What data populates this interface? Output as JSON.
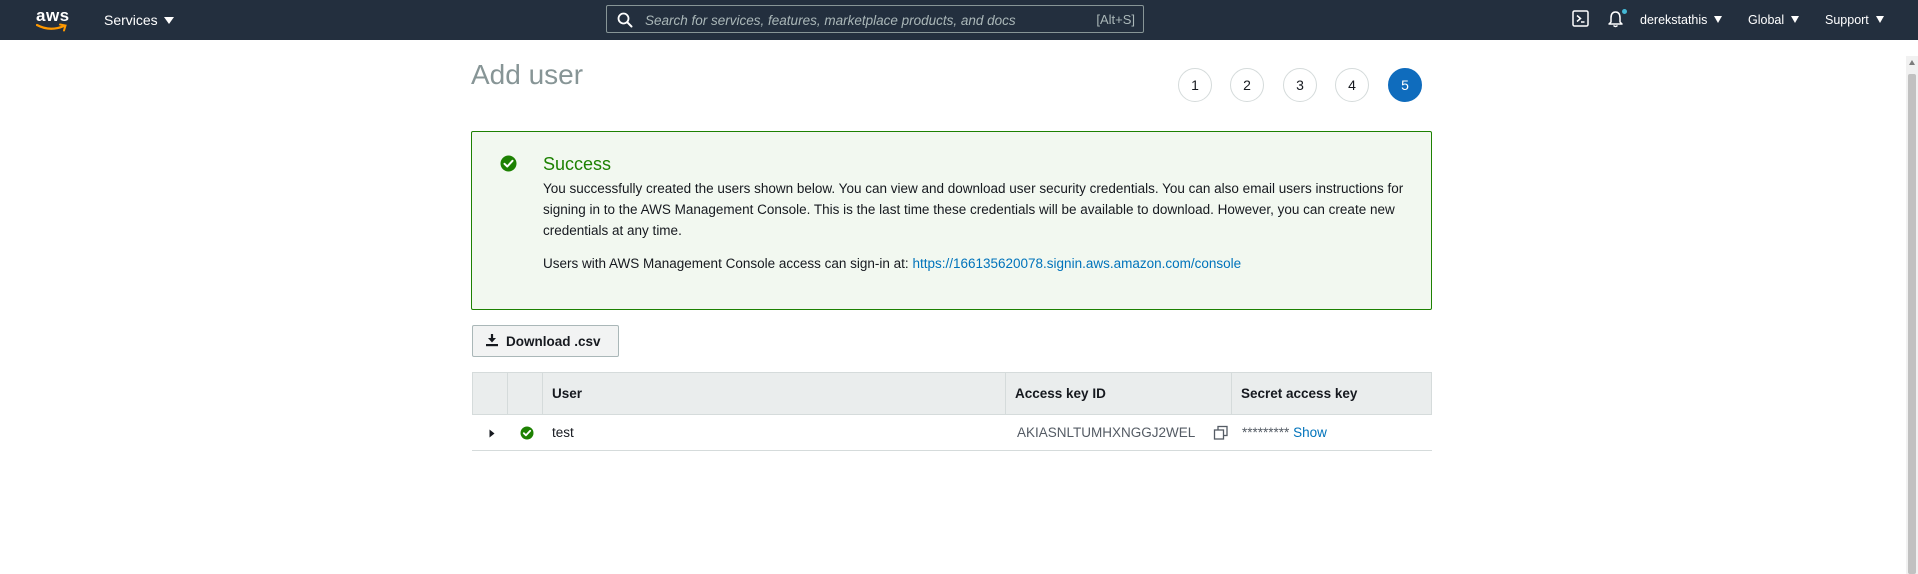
{
  "nav": {
    "logo_text": "aws",
    "services_label": "Services",
    "search_placeholder": "Search for services, features, marketplace products, and docs",
    "search_shortcut": "[Alt+S]",
    "user_label": "derekstathis",
    "region_label": "Global",
    "support_label": "Support"
  },
  "page": {
    "title": "Add user",
    "steps": [
      "1",
      "2",
      "3",
      "4",
      "5"
    ],
    "active_step": "5"
  },
  "success": {
    "title": "Success",
    "message": "You successfully created the users shown below. You can view and download user security credentials. You can also email users instructions for signing in to the AWS Management Console. This is the last time these credentials will be available to download. However, you can create new credentials at any time.",
    "signin_prefix": "Users with AWS Management Console access can sign-in at:",
    "signin_url": "https://166135620078.signin.aws.amazon.com/console"
  },
  "download_label": "Download .csv",
  "table": {
    "headers": {
      "user": "User",
      "access_key": "Access key ID",
      "secret_key": "Secret access key"
    },
    "rows": [
      {
        "user": "test",
        "access_key_id": "AKIASNLTUMHXNGGJ2WEL",
        "secret_masked": "*********",
        "show_label": "Show"
      }
    ]
  },
  "colors": {
    "nav_bg": "#232f3e",
    "success_green": "#1d8102",
    "link_blue": "#0073bb",
    "active_step_blue": "#0f6cbd"
  }
}
